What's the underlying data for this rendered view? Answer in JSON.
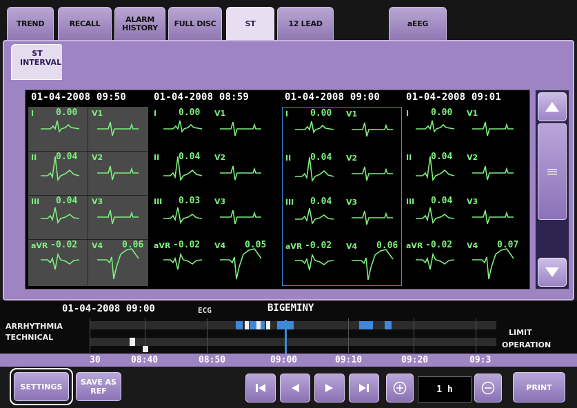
{
  "tabs": [
    "TREND",
    "RECALL",
    "ALARM HISTORY",
    "FULL DISC",
    "ST",
    "12 LEAD",
    "aEEG"
  ],
  "selected_tab": "ST",
  "subtab": "ST INTERVAL",
  "columns": [
    {
      "timestamp": "01-04-2008 09:50",
      "leads": [
        {
          "lead": "I",
          "value": "0.00",
          "lead2": "V1",
          "value2": ""
        },
        {
          "lead": "II",
          "value": "0.04",
          "lead2": "V2",
          "value2": ""
        },
        {
          "lead": "III",
          "value": "0.04",
          "lead2": "V3",
          "value2": ""
        },
        {
          "lead": "aVR",
          "value": "-0.02",
          "lead2": "V4",
          "value2": "0.06"
        }
      ]
    },
    {
      "timestamp": "01-04-2008 08:59",
      "leads": [
        {
          "lead": "I",
          "value": "0.00",
          "lead2": "V1",
          "value2": ""
        },
        {
          "lead": "II",
          "value": "0.04",
          "lead2": "V2",
          "value2": ""
        },
        {
          "lead": "III",
          "value": "0.03",
          "lead2": "V3",
          "value2": ""
        },
        {
          "lead": "aVR",
          "value": "-0.02",
          "lead2": "V4",
          "value2": "0.05"
        }
      ]
    },
    {
      "timestamp": "01-04-2008 09:00",
      "leads": [
        {
          "lead": "I",
          "value": "0.00",
          "lead2": "V1",
          "value2": ""
        },
        {
          "lead": "II",
          "value": "0.04",
          "lead2": "V2",
          "value2": ""
        },
        {
          "lead": "III",
          "value": "0.04",
          "lead2": "V3",
          "value2": ""
        },
        {
          "lead": "aVR",
          "value": "-0.02",
          "lead2": "V4",
          "value2": "0.06"
        }
      ]
    },
    {
      "timestamp": "01-04-2008 09:01",
      "leads": [
        {
          "lead": "I",
          "value": "0.00",
          "lead2": "V1",
          "value2": ""
        },
        {
          "lead": "II",
          "value": "0.04",
          "lead2": "V2",
          "value2": ""
        },
        {
          "lead": "III",
          "value": "0.04",
          "lead2": "V3",
          "value2": ""
        },
        {
          "lead": "aVR",
          "value": "-0.02",
          "lead2": "V4",
          "value2": "0.07"
        }
      ]
    }
  ],
  "timeline": {
    "datetime": "01-04-2008 09:00",
    "source": "ECG",
    "event": "BIGEMINY",
    "row1_label": "ARRHYTHMIA",
    "row2_label": "TECHNICAL",
    "right_label_1": "LIMIT",
    "right_label_2": "OPERATION",
    "axis_ticks": [
      "30",
      "08:40",
      "08:50",
      "09:00",
      "09:10",
      "09:20",
      "09:3"
    ]
  },
  "buttons": {
    "settings": "SETTINGS",
    "save_as_ref": "SAVE AS REF",
    "zoom_value": "1 h",
    "print": "PRINT"
  },
  "colors": {
    "accent": "#9f84c4",
    "waveform": "#7df07d",
    "selection": "#3f8ad8"
  }
}
